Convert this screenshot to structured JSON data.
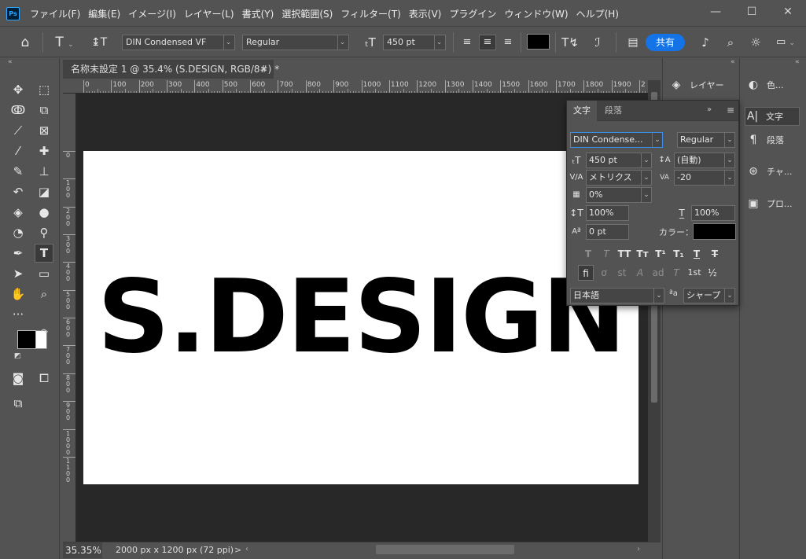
{
  "app": {
    "logo": "Ps"
  },
  "menu": [
    "ファイル(F)",
    "編集(E)",
    "イメージ(I)",
    "レイヤー(L)",
    "書式(Y)",
    "選択範囲(S)",
    "フィルター(T)",
    "表示(V)",
    "プラグイン",
    "ウィンドウ(W)",
    "ヘルプ(H)"
  ],
  "window_controls": {
    "minimize": "—",
    "maximize": "☐",
    "close": "✕"
  },
  "options": {
    "font_family": "DIN Condensed VF",
    "font_style": "Regular",
    "font_size": "450 pt",
    "color_swatch": "#000000",
    "share_label": "共有"
  },
  "document": {
    "tab_title": "名称未設定 1 @ 35.4% (S.DESIGN, RGB/8#) *",
    "tab_close": "×",
    "canvas_text": "S.DESIGN",
    "zoom": "35.35%",
    "info": "2000 px x 1200 px (72 ppi)",
    "status_arrow": ">"
  },
  "ruler": {
    "top": [
      "0",
      "100",
      "200",
      "300",
      "400",
      "500",
      "600",
      "700",
      "800",
      "900",
      "1000",
      "1100",
      "1200",
      "1300",
      "1400",
      "1500",
      "1600",
      "1700",
      "1800",
      "1900",
      "2"
    ],
    "left": [
      "0",
      "100",
      "200",
      "300",
      "400",
      "500",
      "600",
      "700",
      "800",
      "900",
      "1000",
      "1100"
    ]
  },
  "dock": {
    "mid": [
      {
        "label": "レイヤー",
        "icon": "layers-icon"
      }
    ],
    "right": [
      {
        "label": "色...",
        "icon": "color-icon"
      },
      {
        "label": "文字",
        "icon": "character-icon"
      },
      {
        "label": "段落",
        "icon": "paragraph-icon"
      },
      {
        "label": "チャ...",
        "icon": "channels-icon"
      },
      {
        "label": "プロ...",
        "icon": "properties-icon"
      }
    ]
  },
  "char_panel": {
    "tabs": [
      "文字",
      "段落"
    ],
    "font_family": "DIN Condense...",
    "font_style": "Regular",
    "size": "450 pt",
    "leading": "(自動)",
    "kerning": "メトリクス",
    "tracking": "-20",
    "tsume": "0%",
    "vertical_scale": "100%",
    "horizontal_scale": "100%",
    "baseline_shift": "0 pt",
    "color_label": "カラー：",
    "color": "#000000",
    "language": "日本語",
    "antialias_label": "ªa",
    "antialias": "シャープ",
    "style_buttons": [
      "T",
      "T",
      "TT",
      "Tт",
      "T¹",
      "T₁",
      "T",
      "T"
    ],
    "opentype_buttons": [
      "fi",
      "ơ",
      "st",
      "A",
      "ad",
      "T",
      "1st",
      "½"
    ]
  }
}
